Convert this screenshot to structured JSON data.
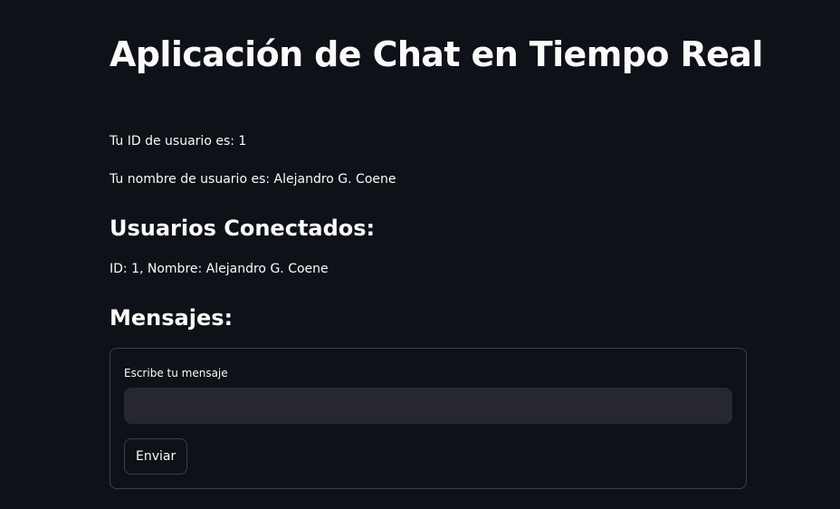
{
  "page": {
    "title": "Aplicación de Chat en Tiempo Real"
  },
  "user": {
    "id_text": "Tu ID de usuario es: 1",
    "name_text": "Tu nombre de usuario es: Alejandro G. Coene"
  },
  "connected_users": {
    "heading": "Usuarios Conectados:",
    "items": [
      "ID: 1, Nombre: Alejandro G. Coene"
    ]
  },
  "messages": {
    "heading": "Mensajes:",
    "form": {
      "input_label": "Escribe tu mensaje",
      "input_value": "",
      "submit_label": "Enviar"
    }
  },
  "colors": {
    "background": "#0e1117",
    "text": "#fafafa",
    "input_background": "#262730",
    "border": "rgba(250,250,250,0.2)"
  }
}
